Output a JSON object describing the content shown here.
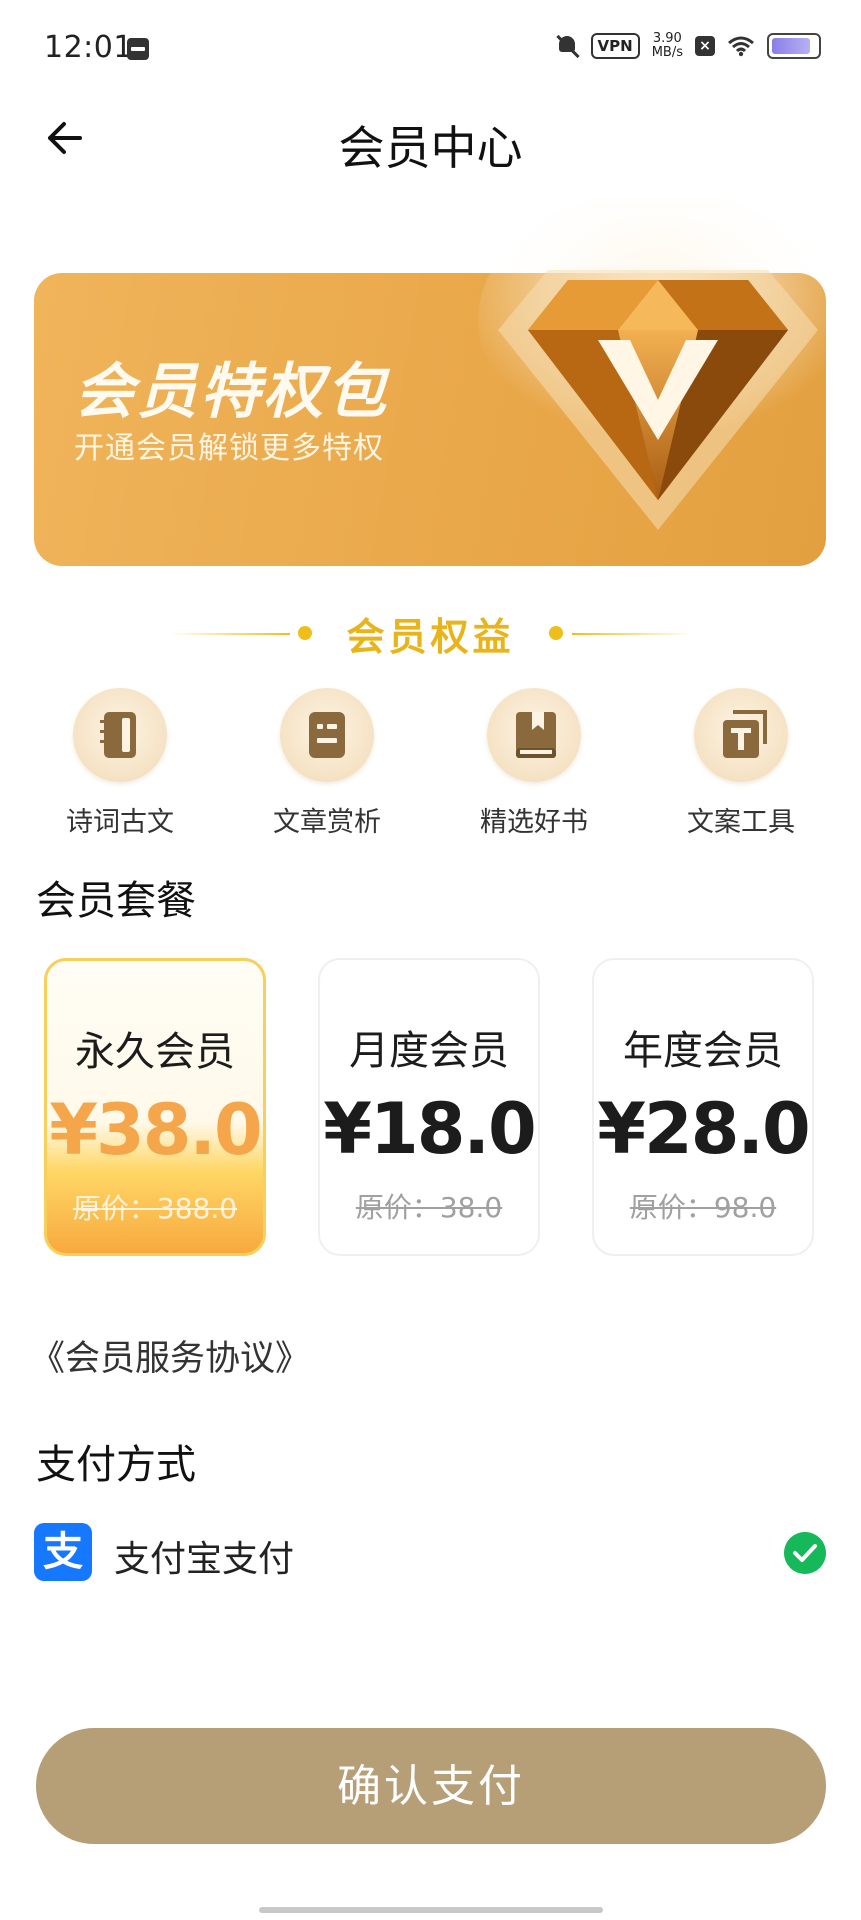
{
  "status_bar": {
    "time": "12:01",
    "vpn": "VPN",
    "speed_value": "3.90",
    "speed_unit": "MB/s"
  },
  "header": {
    "title": "会员中心"
  },
  "banner": {
    "title": "会员特权包",
    "subtitle": "开通会员解锁更多特权"
  },
  "benefits": {
    "title": "会员权益",
    "items": [
      {
        "label": "诗词古文",
        "icon": "notebook-icon"
      },
      {
        "label": "文章赏析",
        "icon": "article-icon"
      },
      {
        "label": "精选好书",
        "icon": "book-icon"
      },
      {
        "label": "文案工具",
        "icon": "text-tool-icon"
      }
    ]
  },
  "packages": {
    "heading": "会员套餐",
    "items": [
      {
        "name": "永久会员",
        "price": "¥38.0",
        "original": "原价：388.0",
        "selected": true
      },
      {
        "name": "月度会员",
        "price": "¥18.0",
        "original": "原价：38.0",
        "selected": false
      },
      {
        "name": "年度会员",
        "price": "¥28.0",
        "original": "原价：98.0",
        "selected": false
      }
    ]
  },
  "agreement": "《会员服务协议》",
  "payment": {
    "heading": "支付方式",
    "method": "支付宝支付",
    "method_icon": "支",
    "selected": true
  },
  "confirm_button": "确认支付",
  "colors": {
    "accent": "#E9A84A",
    "gold": "#F0BE1A",
    "confirm": "#B69E76",
    "check": "#16B95A",
    "alipay": "#1677FF"
  }
}
